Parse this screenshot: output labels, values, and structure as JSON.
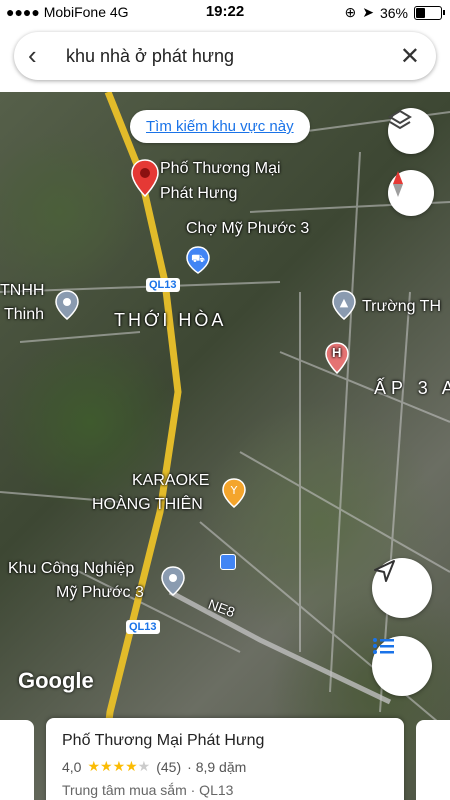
{
  "status": {
    "carrier": "MobiFone",
    "network": "4G",
    "time": "19:22",
    "battery": "36%",
    "battery_level": 0.36
  },
  "search": {
    "query": "khu nhà ở phát hưng"
  },
  "map": {
    "search_area_button": "Tìm kiếm khu vực này",
    "labels": {
      "pho_thuong_mai_1": "Phố Thương Mại",
      "pho_thuong_mai_2": "Phát Hưng",
      "cho": "Chợ Mỹ Phước 3",
      "tnhh_1": "TNHH",
      "tnhh_2": "Thinh",
      "thoi_hoa": "THỚI HÒA",
      "truong": "Trường TH",
      "ap3": "ẤP 3 A",
      "karaoke_1": "KARAOKE",
      "karaoke_2": "HOÀNG THIÊN",
      "kcn_1": "Khu Công Nghiệp",
      "kcn_2": "Mỹ Phước 3",
      "ql13_a": "QL13",
      "ql13_b": "QL13",
      "ne8": "NE8",
      "hospital": "H"
    },
    "google_logo": "Google"
  },
  "card": {
    "title": "Phố Thương Mại Phát Hưng",
    "rating": "4,0",
    "stars": "★★★★",
    "star_empty": "★",
    "reviews": "(45)",
    "distance": "· 8,9 dặm",
    "subtitle": "Trung tâm mua sắm · QL13"
  }
}
